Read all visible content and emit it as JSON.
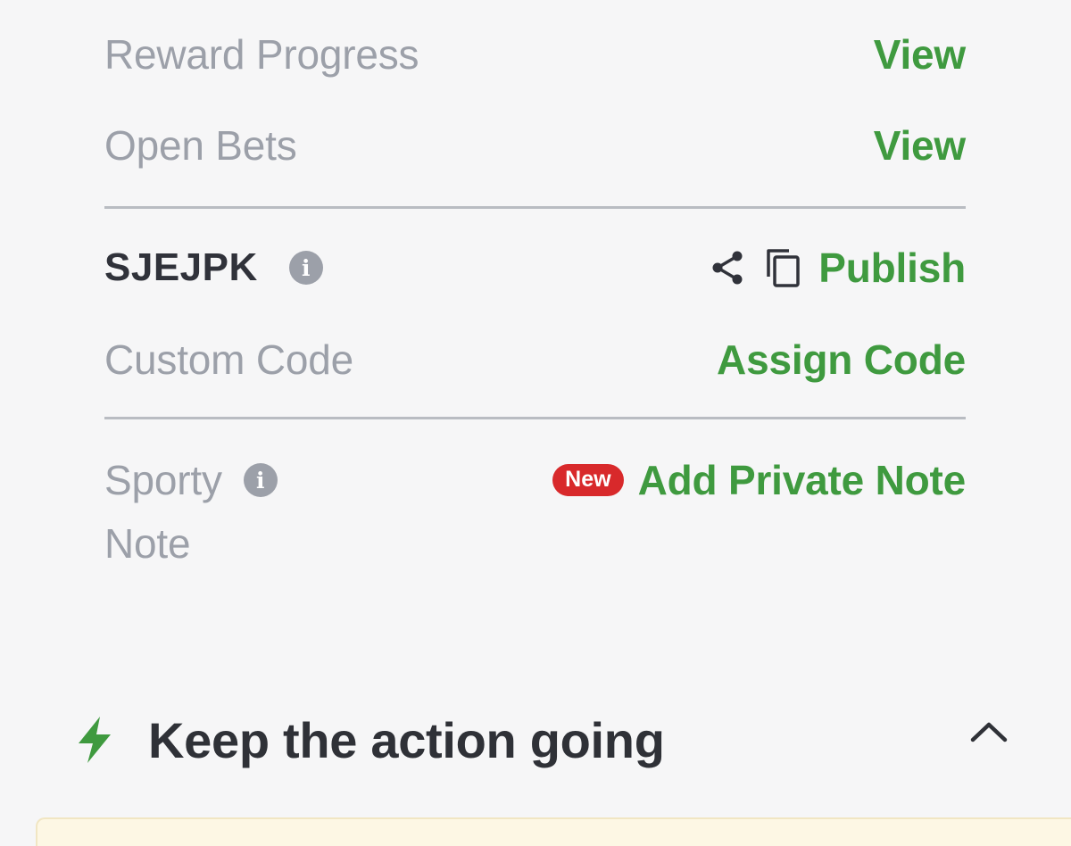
{
  "rows": {
    "reward_progress": {
      "label": "Reward Progress",
      "action": "View"
    },
    "open_bets": {
      "label": "Open Bets",
      "action": "View"
    },
    "booking_code": {
      "code": "SJEJPK",
      "publish": "Publish"
    },
    "custom_code": {
      "label": "Custom Code",
      "action": "Assign Code"
    },
    "sporty_note": {
      "label_line1": "Sporty",
      "label_line2": "Note",
      "badge": "New",
      "action": "Add Private Note"
    }
  },
  "section": {
    "title": "Keep the action going",
    "icon": "lightning-icon",
    "toggle_icon": "chevron-up-icon"
  },
  "colors": {
    "accent_green": "#3f9a3f",
    "badge_red": "#d8292b",
    "muted_text": "#9ca0a9",
    "dark_text": "#30323a"
  }
}
